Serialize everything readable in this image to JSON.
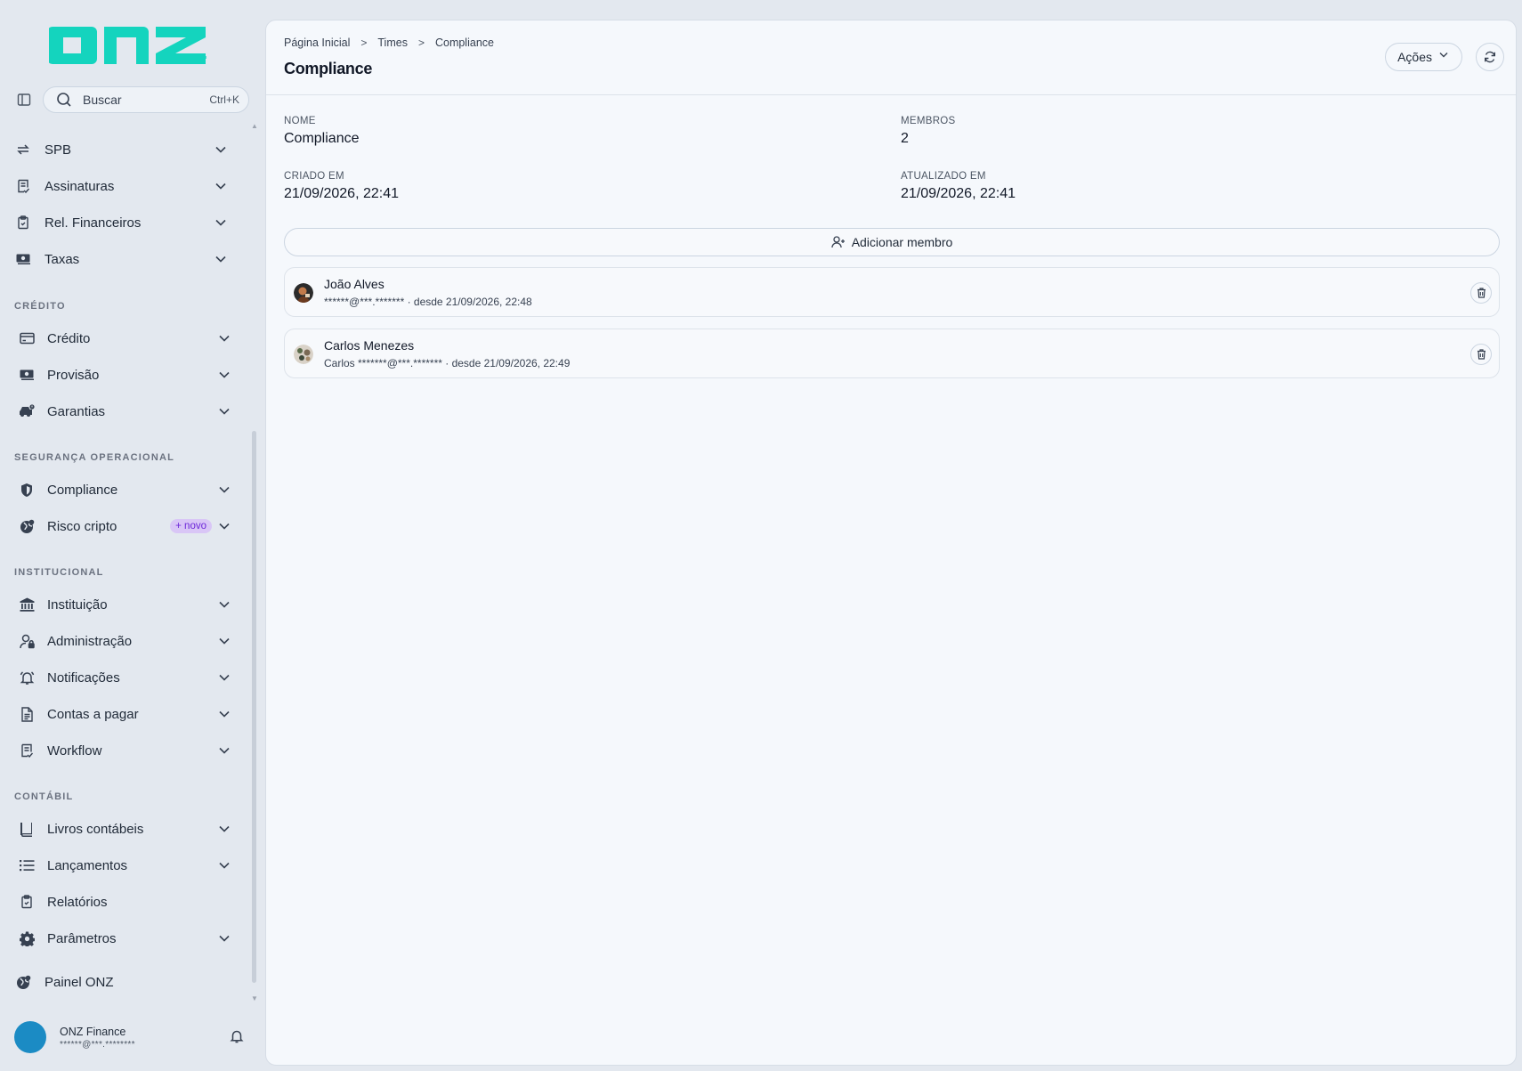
{
  "brand": {
    "logo_text": "onz",
    "color": "#14d4be"
  },
  "search": {
    "label": "Buscar",
    "shortcut": "Ctrl+K"
  },
  "sidebar": {
    "top_items": [
      {
        "label": "SPB",
        "icon": "arrows-swap-icon"
      },
      {
        "label": "Assinaturas",
        "icon": "document-check-icon"
      },
      {
        "label": "Rel. Financeiros",
        "icon": "clipboard-icon"
      },
      {
        "label": "Taxas",
        "icon": "money-icon"
      }
    ],
    "sections": [
      {
        "title": "CRÉDITO",
        "items": [
          {
            "label": "Crédito",
            "icon": "card-icon"
          },
          {
            "label": "Provisão",
            "icon": "money-icon"
          },
          {
            "label": "Garantias",
            "icon": "car-alert-icon"
          }
        ]
      },
      {
        "title": "SEGURANÇA OPERACIONAL",
        "items": [
          {
            "label": "Compliance",
            "icon": "shield-icon"
          },
          {
            "label": "Risco cripto",
            "icon": "globe-icon",
            "badge": "+ novo"
          }
        ]
      },
      {
        "title": "INSTITUCIONAL",
        "items": [
          {
            "label": "Instituição",
            "icon": "bank-icon"
          },
          {
            "label": "Administração",
            "icon": "user-lock-icon"
          },
          {
            "label": "Notificações",
            "icon": "bell-icon"
          },
          {
            "label": "Contas a pagar",
            "icon": "file-icon"
          },
          {
            "label": "Workflow",
            "icon": "document-check-icon"
          }
        ]
      },
      {
        "title": "CONTÁBIL",
        "items": [
          {
            "label": "Livros contábeis",
            "icon": "book-icon"
          },
          {
            "label": "Lançamentos",
            "icon": "list-icon"
          },
          {
            "label": "Relatórios",
            "icon": "clipboard-icon"
          },
          {
            "label": "Parâmetros",
            "icon": "gear-icon"
          }
        ]
      }
    ],
    "footer_item": {
      "label": "Painel ONZ",
      "icon": "globe-icon"
    },
    "user": {
      "name": "ONZ Finance",
      "email": "******@***.********"
    }
  },
  "breadcrumb": [
    "Página Inicial",
    "Times",
    "Compliance"
  ],
  "page": {
    "title": "Compliance"
  },
  "actions": {
    "acoes_label": "Ações"
  },
  "details": {
    "nome_label": "NOME",
    "nome_value": "Compliance",
    "membros_label": "MEMBROS",
    "membros_value": "2",
    "criado_label": "CRIADO EM",
    "criado_value": "21/09/2026, 22:41",
    "atualizado_label": "ATUALIZADO EM",
    "atualizado_value": "21/09/2026, 22:41"
  },
  "add_member_label": "Adicionar membro",
  "members": [
    {
      "name": "João Alves",
      "meta": "******@***.******* · desde 21/09/2026, 22:48"
    },
    {
      "name": "Carlos Menezes",
      "meta": "Carlos *******@***.******* · desde 21/09/2026, 22:49"
    }
  ]
}
